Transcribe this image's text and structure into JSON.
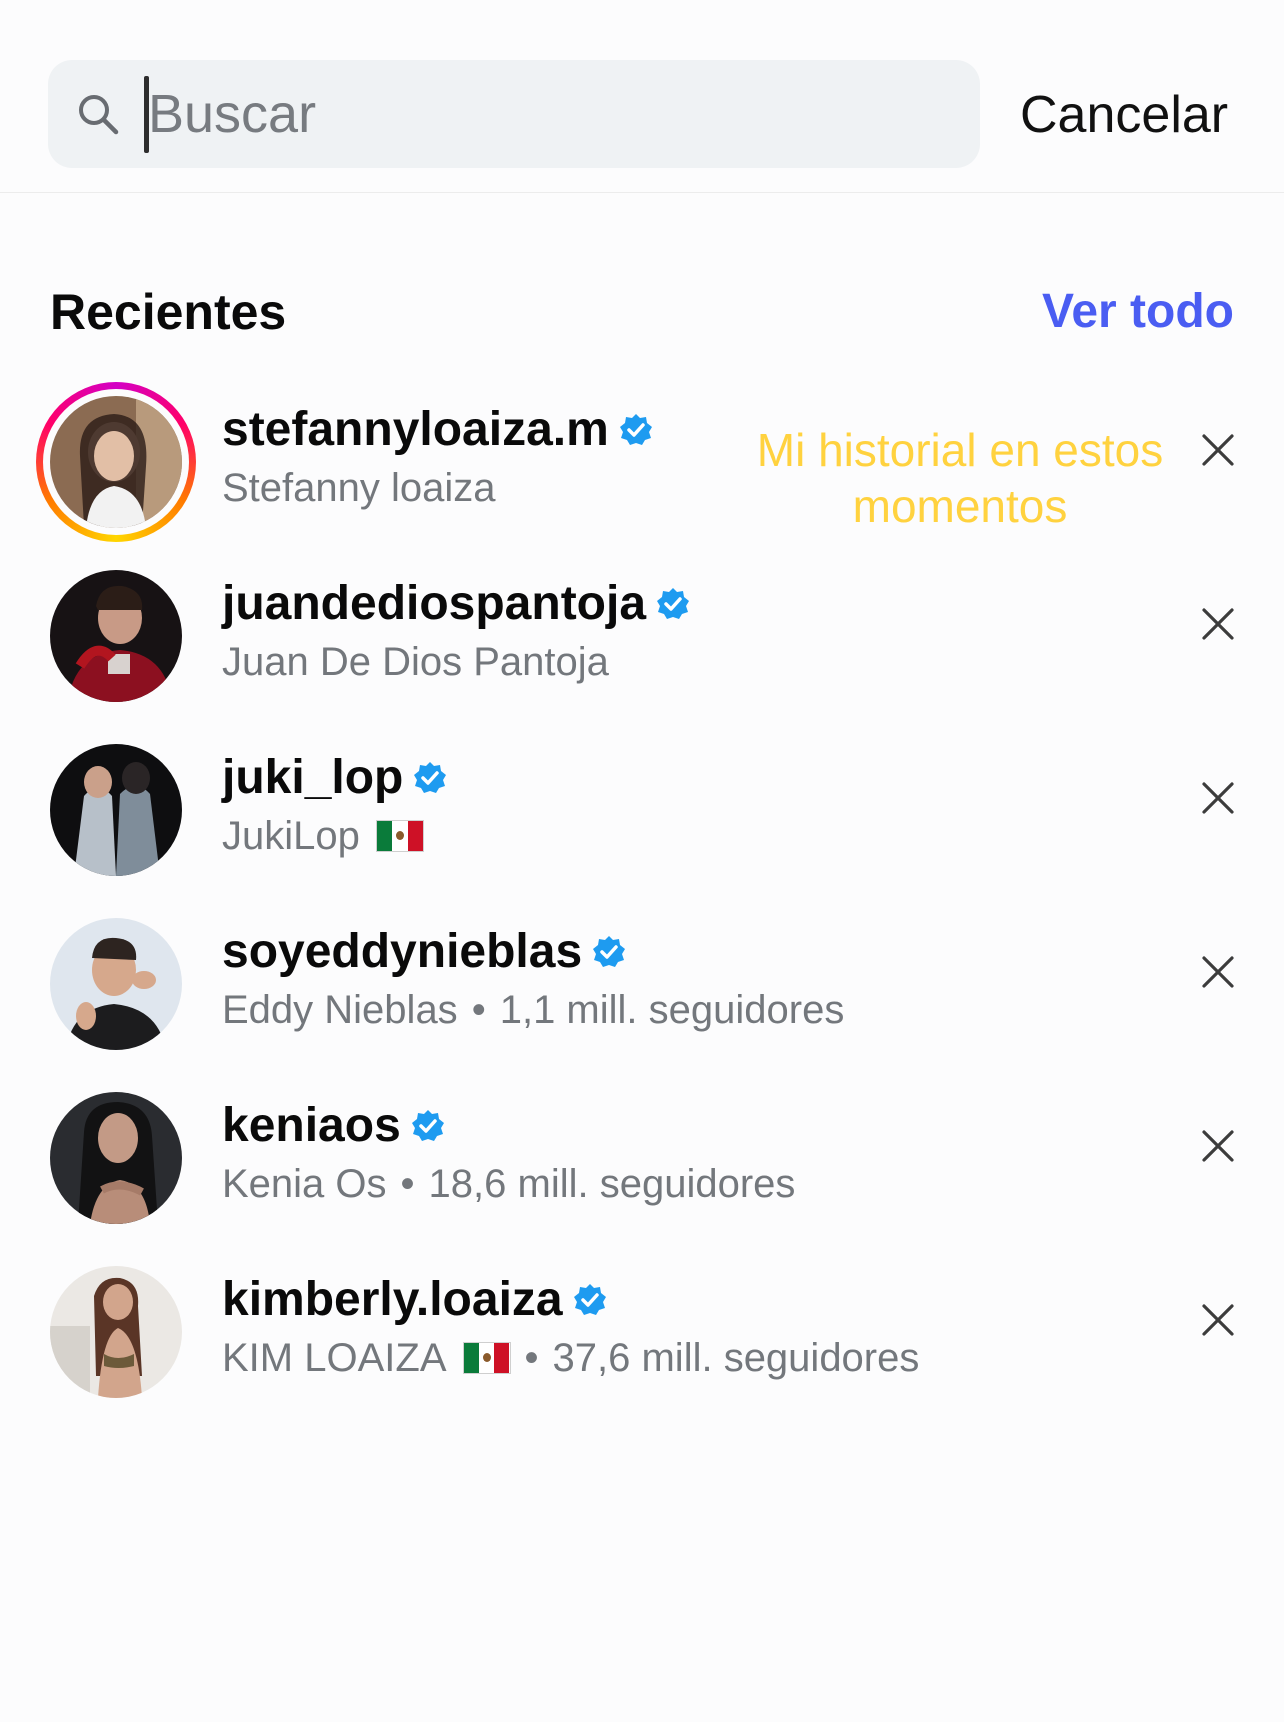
{
  "search": {
    "placeholder": "Buscar",
    "value": "",
    "cancel_label": "Cancelar"
  },
  "recents": {
    "title": "Recientes",
    "see_all_label": "Ver todo",
    "items": [
      {
        "username": "stefannyloaiza.m",
        "subtitle": "Stefanny loaiza",
        "verified": true,
        "has_story": true,
        "flag": false,
        "followers": ""
      },
      {
        "username": "juandediospantoja",
        "subtitle": "Juan De Dios Pantoja",
        "verified": true,
        "has_story": false,
        "flag": false,
        "followers": ""
      },
      {
        "username": "juki_lop",
        "subtitle": "JukiLop",
        "verified": true,
        "has_story": false,
        "flag": true,
        "followers": ""
      },
      {
        "username": "soyeddynieblas",
        "subtitle": "Eddy Nieblas",
        "verified": true,
        "has_story": false,
        "flag": false,
        "followers": "1,1 mill. seguidores"
      },
      {
        "username": "keniaos",
        "subtitle": "Kenia Os",
        "verified": true,
        "has_story": false,
        "flag": false,
        "followers": "18,6 mill. seguidores"
      },
      {
        "username": "kimberly.loaiza",
        "subtitle": "KIM LOAIZA",
        "verified": true,
        "has_story": false,
        "flag": true,
        "followers": "37,6 mill. seguidores"
      }
    ]
  },
  "annotation": {
    "text": "Mi historial en estos momentos",
    "color": "#ffd23f"
  },
  "colors": {
    "accent": "#4a5df2",
    "verified": "#1e9bf0",
    "secondary_text": "#73777c",
    "search_bg": "#eff2f4"
  },
  "icons": {
    "search": "search-icon",
    "verified": "verified-badge-icon",
    "remove": "close-icon",
    "flag": "mexico-flag-icon"
  }
}
